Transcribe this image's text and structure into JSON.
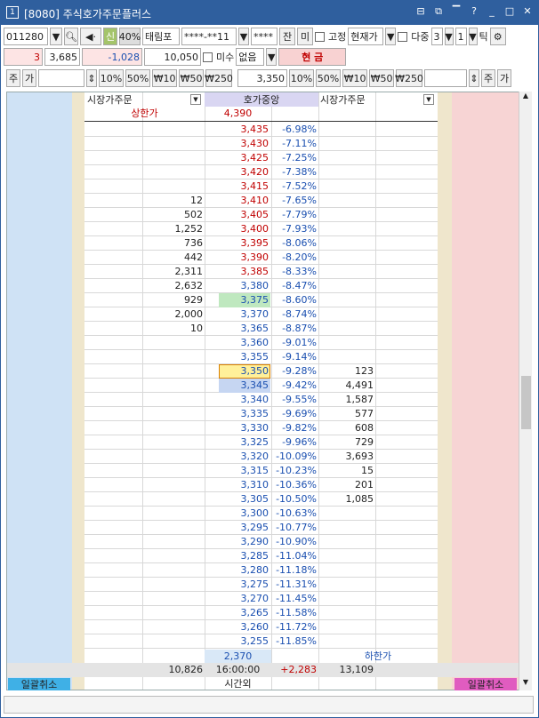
{
  "window": {
    "badge": "1",
    "title": "[8080]  주식호가주문플러스"
  },
  "toolbar": {
    "code": "011280",
    "sin": "신",
    "pct": "40%",
    "stock_name": "태림포",
    "account": "****-**11",
    "password": "****",
    "jan": "잔",
    "mi": "미",
    "fixed": "고정",
    "price_type": "현재가",
    "multi": "다중",
    "multi_n": "3",
    "tick_n": "1",
    "tick": "틱"
  },
  "row2": {
    "qty": "3",
    "price": "3,685",
    "diff": "-1,028",
    "amount": "10,050",
    "misu": "미수",
    "none": "없음",
    "cash": "현 금"
  },
  "row3": {
    "ju": "주",
    "ga": "가",
    "p10": "10%",
    "p50": "50%",
    "w10": "₩10",
    "w50": "₩50",
    "w250": "₩250",
    "price_input": "3,350",
    "ju2": "주",
    "ga2": "가"
  },
  "headers": {
    "market_left": "시장가주문",
    "center": "호가중앙",
    "market_right": "시장가주문"
  },
  "upper_limit": {
    "label": "상한가",
    "price": "4,390"
  },
  "rows": [
    {
      "sell": "",
      "price": "3,435",
      "pct": "-6.98%",
      "buy": "",
      "pc": "red"
    },
    {
      "sell": "",
      "price": "3,430",
      "pct": "-7.11%",
      "buy": "",
      "pc": "red"
    },
    {
      "sell": "",
      "price": "3,425",
      "pct": "-7.25%",
      "buy": "",
      "pc": "red"
    },
    {
      "sell": "",
      "price": "3,420",
      "pct": "-7.38%",
      "buy": "",
      "pc": "red"
    },
    {
      "sell": "",
      "price": "3,415",
      "pct": "-7.52%",
      "buy": "",
      "pc": "red"
    },
    {
      "sell": "12",
      "price": "3,410",
      "pct": "-7.65%",
      "buy": "",
      "pc": "red"
    },
    {
      "sell": "502",
      "price": "3,405",
      "pct": "-7.79%",
      "buy": "",
      "pc": "red"
    },
    {
      "sell": "1,252",
      "price": "3,400",
      "pct": "-7.93%",
      "buy": "",
      "pc": "red"
    },
    {
      "sell": "736",
      "price": "3,395",
      "pct": "-8.06%",
      "buy": "",
      "pc": "red"
    },
    {
      "sell": "442",
      "price": "3,390",
      "pct": "-8.20%",
      "buy": "",
      "pc": "red"
    },
    {
      "sell": "2,311",
      "price": "3,385",
      "pct": "-8.33%",
      "buy": "",
      "pc": "red"
    },
    {
      "sell": "2,632",
      "price": "3,380",
      "pct": "-8.47%",
      "buy": "",
      "pc": "blue"
    },
    {
      "sell": "929",
      "price": "3,375",
      "pct": "-8.60%",
      "buy": "",
      "pc": "blue",
      "hl": "#bfe8bf"
    },
    {
      "sell": "2,000",
      "price": "3,370",
      "pct": "-8.74%",
      "buy": "",
      "pc": "blue"
    },
    {
      "sell": "10",
      "price": "3,365",
      "pct": "-8.87%",
      "buy": "",
      "pc": "blue"
    },
    {
      "sell": "",
      "price": "3,360",
      "pct": "-9.01%",
      "buy": "",
      "pc": "blue"
    },
    {
      "sell": "",
      "price": "3,355",
      "pct": "-9.14%",
      "buy": "",
      "pc": "blue"
    },
    {
      "sell": "",
      "price": "3,350",
      "pct": "-9.28%",
      "buy": "123",
      "pc": "blue",
      "hl": "#fff09a",
      "box": true
    },
    {
      "sell": "",
      "price": "3,345",
      "pct": "-9.42%",
      "buy": "4,491",
      "pc": "blue",
      "hl": "#c6d6f2"
    },
    {
      "sell": "",
      "price": "3,340",
      "pct": "-9.55%",
      "buy": "1,587",
      "pc": "blue"
    },
    {
      "sell": "",
      "price": "3,335",
      "pct": "-9.69%",
      "buy": "577",
      "pc": "blue"
    },
    {
      "sell": "",
      "price": "3,330",
      "pct": "-9.82%",
      "buy": "608",
      "pc": "blue"
    },
    {
      "sell": "",
      "price": "3,325",
      "pct": "-9.96%",
      "buy": "729",
      "pc": "blue"
    },
    {
      "sell": "",
      "price": "3,320",
      "pct": "-10.09%",
      "buy": "3,693",
      "pc": "blue"
    },
    {
      "sell": "",
      "price": "3,315",
      "pct": "-10.23%",
      "buy": "15",
      "pc": "blue"
    },
    {
      "sell": "",
      "price": "3,310",
      "pct": "-10.36%",
      "buy": "201",
      "pc": "blue"
    },
    {
      "sell": "",
      "price": "3,305",
      "pct": "-10.50%",
      "buy": "1,085",
      "pc": "blue"
    },
    {
      "sell": "",
      "price": "3,300",
      "pct": "-10.63%",
      "buy": "",
      "pc": "blue"
    },
    {
      "sell": "",
      "price": "3,295",
      "pct": "-10.77%",
      "buy": "",
      "pc": "blue"
    },
    {
      "sell": "",
      "price": "3,290",
      "pct": "-10.90%",
      "buy": "",
      "pc": "blue"
    },
    {
      "sell": "",
      "price": "3,285",
      "pct": "-11.04%",
      "buy": "",
      "pc": "blue"
    },
    {
      "sell": "",
      "price": "3,280",
      "pct": "-11.18%",
      "buy": "",
      "pc": "blue"
    },
    {
      "sell": "",
      "price": "3,275",
      "pct": "-11.31%",
      "buy": "",
      "pc": "blue"
    },
    {
      "sell": "",
      "price": "3,270",
      "pct": "-11.45%",
      "buy": "",
      "pc": "blue"
    },
    {
      "sell": "",
      "price": "3,265",
      "pct": "-11.58%",
      "buy": "",
      "pc": "blue"
    },
    {
      "sell": "",
      "price": "3,260",
      "pct": "-11.72%",
      "buy": "",
      "pc": "blue"
    },
    {
      "sell": "",
      "price": "3,255",
      "pct": "-11.85%",
      "buy": "",
      "pc": "blue"
    }
  ],
  "lower_limit": {
    "price": "2,370",
    "label": "하한가"
  },
  "summary": {
    "sell_total": "10,826",
    "time": "16:00:00",
    "diff": "+2,283",
    "buy_total": "13,109",
    "after_hours": "시간외"
  },
  "footer": {
    "cancel_left": "일괄취소",
    "cancel_right": "일괄취소"
  }
}
